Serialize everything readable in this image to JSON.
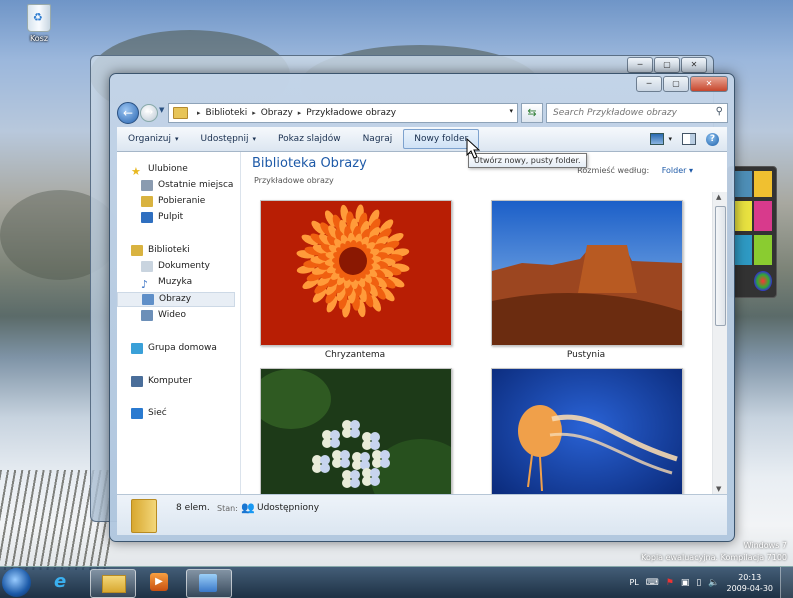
{
  "desktop": {
    "recycle_bin_label": "Kosz",
    "watermark": [
      "Windows 7",
      "Kopia ewaluacyjna. Kompilacja 7100"
    ]
  },
  "window": {
    "controls": {
      "minimize": "─",
      "maximize": "▢",
      "close": "✕"
    },
    "address": {
      "crumbs": [
        "Biblioteki",
        "Obrazy",
        "Przykładowe obrazy"
      ],
      "separator": "▸",
      "dropdown": "▾"
    },
    "search_placeholder": "Search Przykładowe obrazy",
    "toolbar": {
      "items": [
        {
          "label": "Organizuj",
          "arrow": "▾"
        },
        {
          "label": "Udostępnij",
          "arrow": "▾"
        },
        {
          "label": "Pokaz slajdów",
          "arrow": ""
        },
        {
          "label": "Nagraj",
          "arrow": ""
        },
        {
          "label": "Nowy folder",
          "arrow": ""
        }
      ],
      "views_arrow": "▾",
      "help": "?"
    },
    "nav": {
      "items": [
        {
          "label": "Ulubione",
          "icon": "star-icon",
          "color": "#e8b820",
          "level": 0
        },
        {
          "label": "Ostatnie miejsca",
          "icon": "recent-places-icon",
          "color": "#8a9bb0",
          "level": 1
        },
        {
          "label": "Pobieranie",
          "icon": "downloads-icon",
          "color": "#d9b340",
          "level": 1
        },
        {
          "label": "Pulpit",
          "icon": "desktop-icon",
          "color": "#2f6fc0",
          "level": 1
        },
        {
          "label": "Biblioteki",
          "icon": "libraries-icon",
          "color": "#d9b340",
          "level": 0
        },
        {
          "label": "Dokumenty",
          "icon": "documents-icon",
          "color": "#c9d4df",
          "level": 1
        },
        {
          "label": "Muzyka",
          "icon": "music-icon",
          "color": "#3a72c4",
          "level": 1
        },
        {
          "label": "Obrazy",
          "icon": "pictures-icon",
          "color": "#5f8fc8",
          "level": 1,
          "selected": true
        },
        {
          "label": "Wideo",
          "icon": "video-icon",
          "color": "#6c8fb8",
          "level": 1
        },
        {
          "label": "Grupa domowa",
          "icon": "homegroup-icon",
          "color": "#3aa0d8",
          "level": 0
        },
        {
          "label": "Komputer",
          "icon": "computer-icon",
          "color": "#4a6e9a",
          "level": 0
        },
        {
          "label": "Sieć",
          "icon": "network-icon",
          "color": "#2a7ad0",
          "level": 0
        }
      ]
    },
    "content": {
      "title": "Biblioteka Obrazy",
      "subtitle": "Przykładowe obrazy",
      "arrange_label": "Rozmieść według:",
      "arrange_value": "Folder",
      "arrange_arrow": "▾",
      "thumbnails": [
        {
          "caption": "Chryzantema",
          "subject": "chrysanthemum",
          "colors": [
            "#f06010",
            "#b81e04",
            "#ff9b3a"
          ]
        },
        {
          "caption": "Pustynia",
          "subject": "desert",
          "colors": [
            "#2f78d8",
            "#b85a22",
            "#6b2c10"
          ]
        },
        {
          "caption": "",
          "subject": "hydrangeas",
          "colors": [
            "#1d3a18",
            "#c7d4ee",
            "#e8ecd8"
          ]
        },
        {
          "caption": "",
          "subject": "jellyfish",
          "colors": [
            "#05206a",
            "#2a63d6",
            "#f0a04a"
          ]
        }
      ]
    },
    "details": {
      "count": "8 elem.",
      "status_label": "Stan:",
      "status_value": "Udostępniony"
    },
    "tooltip": "Utwórz nowy, pusty folder."
  },
  "taskbar": {
    "lang": "PL",
    "time": "20:13",
    "date": "2009-04-30"
  }
}
